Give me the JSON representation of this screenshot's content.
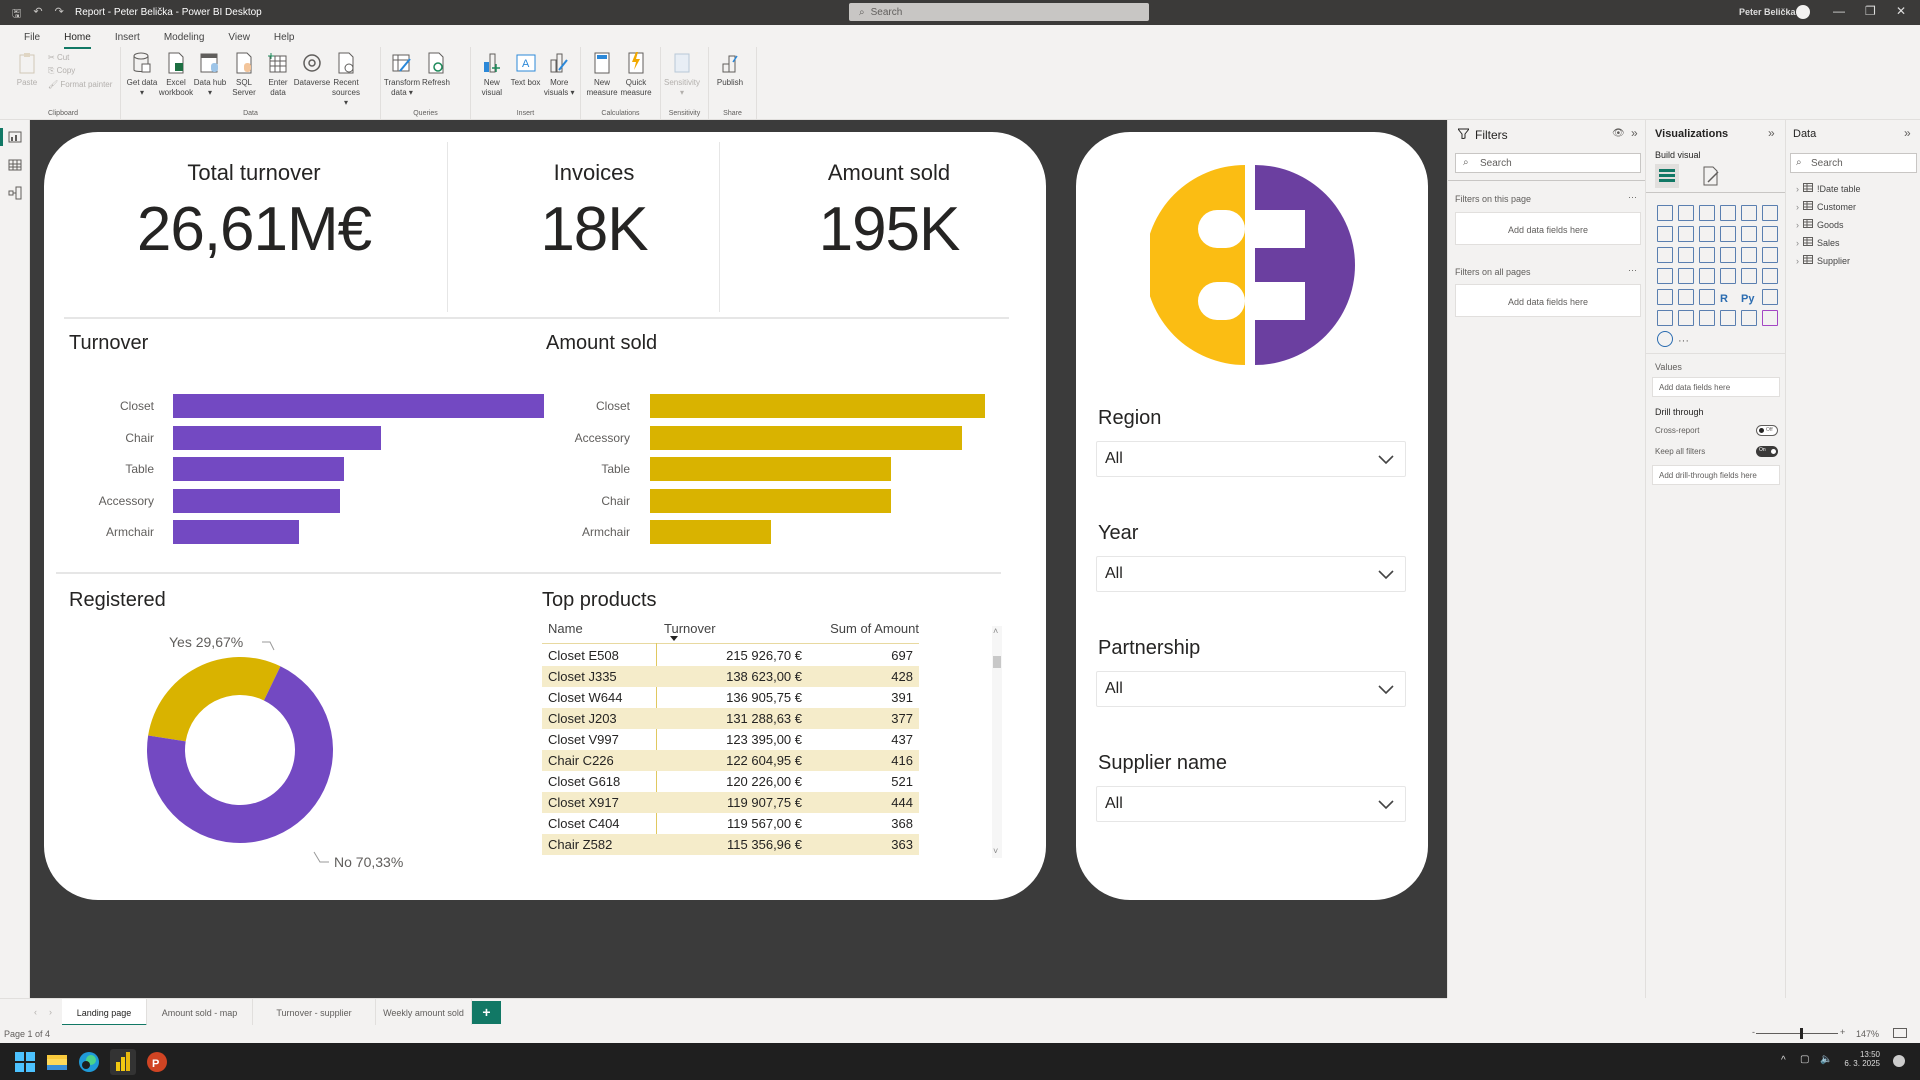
{
  "window": {
    "title": "Report - Peter Belička - Power BI Desktop",
    "search_placeholder": "Search",
    "user_name": "Peter Belička"
  },
  "menu": {
    "items": [
      "File",
      "Home",
      "Insert",
      "Modeling",
      "View",
      "Help"
    ],
    "active": "Home"
  },
  "ribbon": {
    "clipboard": {
      "paste": "Paste",
      "cut": "Cut",
      "copy": "Copy",
      "format_painter": "Format painter",
      "group": "Clipboard"
    },
    "data": {
      "get_data": "Get data ▾",
      "excel": "Excel workbook",
      "data_hub": "Data hub ▾",
      "sql": "SQL Server",
      "enter_data": "Enter data",
      "dataverse": "Dataverse",
      "recent": "Recent sources ▾",
      "group": "Data"
    },
    "queries": {
      "transform": "Transform data ▾",
      "refresh": "Refresh",
      "group": "Queries"
    },
    "insert": {
      "new_visual": "New visual",
      "text_box": "Text box",
      "more_visuals": "More visuals ▾",
      "group": "Insert"
    },
    "calculations": {
      "new_measure": "New measure",
      "quick_measure": "Quick measure",
      "group": "Calculations"
    },
    "sensitivity": {
      "label": "Sensitivity ▾",
      "group": "Sensitivity"
    },
    "share": {
      "publish": "Publish",
      "group": "Share"
    }
  },
  "kpis": [
    {
      "title": "Total turnover",
      "value": "26,61M€"
    },
    {
      "title": "Invoices",
      "value": "18K"
    },
    {
      "title": "Amount sold",
      "value": "195K"
    }
  ],
  "colors": {
    "purple": "#7349c2",
    "gold": "#d9b300",
    "logo_yellow": "#fbbd13",
    "logo_purple": "#6b3fa0",
    "accent": "#117865",
    "table_stripe": "#f5ecca",
    "canvas_bg": "#3b3b3b"
  },
  "chart_data": [
    {
      "type": "bar",
      "title": "Turnover",
      "orientation": "horizontal",
      "categories": [
        "Closet",
        "Chair",
        "Table",
        "Accessory",
        "Armchair"
      ],
      "values": [
        1.0,
        0.56,
        0.46,
        0.45,
        0.34
      ],
      "value_unit": "relative to max (no axis shown)",
      "color": "#7349c2"
    },
    {
      "type": "bar",
      "title": "Amount sold",
      "orientation": "horizontal",
      "categories": [
        "Closet",
        "Accessory",
        "Table",
        "Chair",
        "Armchair"
      ],
      "values": [
        1.0,
        0.93,
        0.72,
        0.72,
        0.36
      ],
      "value_unit": "relative to max (no axis shown)",
      "color": "#d9b300"
    },
    {
      "type": "pie",
      "variant": "donut",
      "title": "Registered",
      "slices": [
        {
          "label": "Yes",
          "value": 29.67,
          "display": "Yes 29,67%",
          "color": "#d9b300"
        },
        {
          "label": "No",
          "value": 70.33,
          "display": "No 70,33%",
          "color": "#7349c2"
        }
      ]
    },
    {
      "type": "table",
      "title": "Top products",
      "columns": [
        "Name",
        "Turnover",
        "Sum of Amount"
      ],
      "sorted_by": "Turnover",
      "rows": [
        [
          "Closet E508",
          "215 926,70 €",
          "697"
        ],
        [
          "Closet J335",
          "138 623,00 €",
          "428"
        ],
        [
          "Closet W644",
          "136 905,75 €",
          "391"
        ],
        [
          "Closet J203",
          "131 288,63 €",
          "377"
        ],
        [
          "Closet V997",
          "123 395,00 €",
          "437"
        ],
        [
          "Chair C226",
          "122 604,95 €",
          "416"
        ],
        [
          "Closet G618",
          "120 226,00 €",
          "521"
        ],
        [
          "Closet X917",
          "119 907,75 €",
          "444"
        ],
        [
          "Closet C404",
          "119 567,00 €",
          "368"
        ],
        [
          "Chair Z582",
          "115 356,96 €",
          "363"
        ]
      ]
    }
  ],
  "slicers": [
    {
      "label": "Region",
      "value": "All"
    },
    {
      "label": "Year",
      "value": "All"
    },
    {
      "label": "Partnership",
      "value": "All"
    },
    {
      "label": "Supplier name",
      "value": "All"
    }
  ],
  "filters_pane": {
    "title": "Filters",
    "search_placeholder": "Search",
    "on_this_page": "Filters on this page",
    "on_all_pages": "Filters on all pages",
    "add_fields": "Add data fields here"
  },
  "visualizations_pane": {
    "title": "Visualizations",
    "build_visual": "Build visual",
    "values_label": "Values",
    "values_drop": "Add data fields here",
    "drill_through": "Drill through",
    "cross_report": "Cross-report",
    "cross_report_state": "Off",
    "keep_all_filters": "Keep all filters",
    "keep_all_filters_state": "On",
    "drill_drop": "Add drill-through fields here"
  },
  "data_pane": {
    "title": "Data",
    "search_placeholder": "Search",
    "tables": [
      "!Date table",
      "Customer",
      "Goods",
      "Sales",
      "Supplier"
    ]
  },
  "page_tabs": {
    "tabs": [
      "Landing page",
      "Amount sold - map",
      "Turnover - supplier",
      "Weekly amount sold"
    ],
    "active": 0,
    "add_label": "+"
  },
  "status": {
    "page": "Page 1 of 4",
    "zoom": "147%"
  },
  "taskbar": {
    "time": "13:50",
    "date": "6. 3. 2025"
  }
}
